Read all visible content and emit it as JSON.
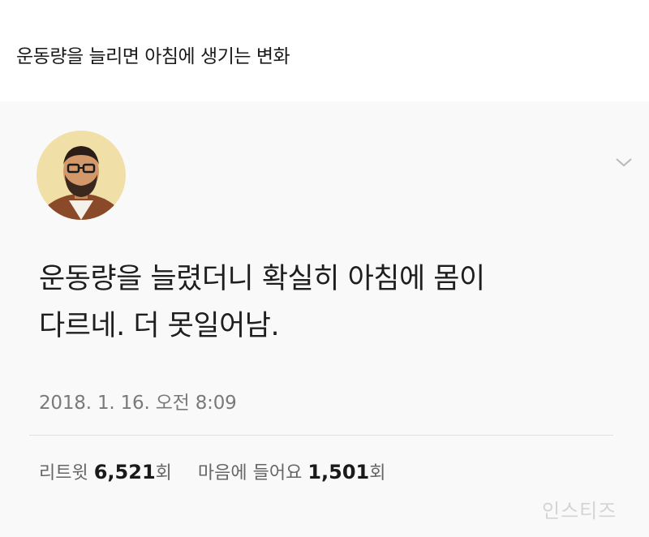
{
  "post": {
    "title": "운동량을 늘리면 아침에 생기는 변화"
  },
  "tweet": {
    "avatar_icon": "profile-avatar",
    "menu_icon": "chevron-down-icon",
    "text_line1": "운동량을 늘렸더니 확실히 아침에 몸이",
    "text_line2": "다르네. 더 못일어남.",
    "timestamp": "2018. 1. 16. 오전 8:09",
    "retweets_label": "리트윗",
    "retweets_count": "6,521",
    "retweets_unit": "회",
    "likes_label": "마음에 들어요",
    "likes_count": "1,501",
    "likes_unit": "회"
  },
  "watermark": "인스티즈",
  "colors": {
    "background": "#ffffff",
    "card": "#f9f9f9",
    "text": "#1e1e1e",
    "muted": "#7a7a7a",
    "divider": "#e1e1e1"
  }
}
